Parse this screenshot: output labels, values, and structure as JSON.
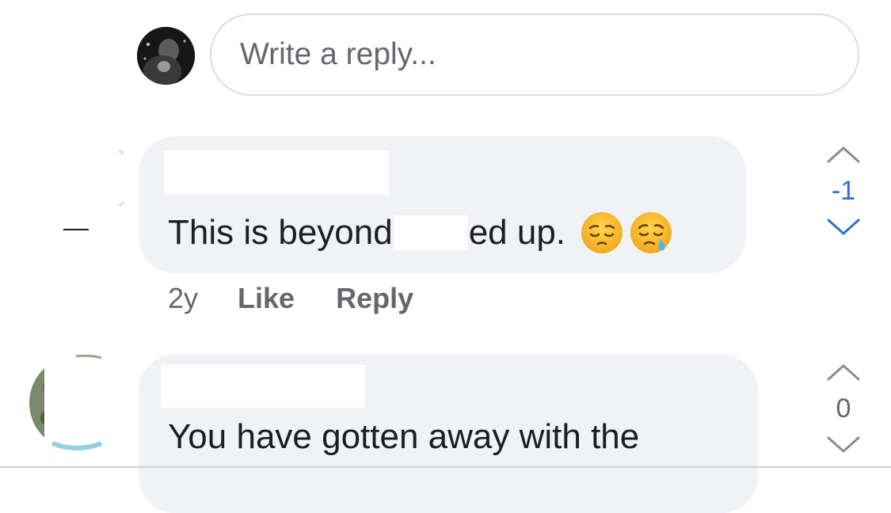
{
  "composer": {
    "placeholder": "Write a reply..."
  },
  "comments": [
    {
      "text_before": "This is beyond",
      "text_after": "ed up.",
      "emojis": [
        "pensive-face-icon",
        "sleepy-face-icon"
      ],
      "time": "2y",
      "like_label": "Like",
      "reply_label": "Reply",
      "vote_count": "-1",
      "vote_color": "#2d6fd8"
    },
    {
      "text": "You have gotten away with the",
      "vote_count": "0",
      "vote_color": "#65676b"
    }
  ],
  "colors": {
    "bubble": "#f0f2f5",
    "secondary_text": "#65676b",
    "vote_arrow": "#8a8d91",
    "vote_accent": "#2d6fd8"
  }
}
